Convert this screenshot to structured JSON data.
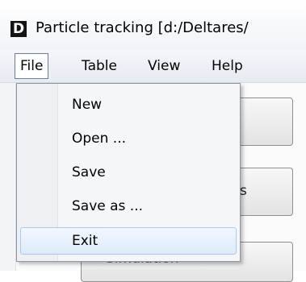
{
  "window": {
    "app_icon_letter": "D",
    "title": "Particle tracking  [d:/Deltares/"
  },
  "menubar": {
    "items": [
      {
        "label": "File",
        "active": true
      },
      {
        "label": "Table"
      },
      {
        "label": "View"
      },
      {
        "label": "Help"
      }
    ]
  },
  "file_menu": {
    "items": [
      {
        "label": "New"
      },
      {
        "label": "Open ..."
      },
      {
        "label": "Save"
      },
      {
        "label": "Save as ..."
      },
      {
        "label": "Exit",
        "highlighted": true
      }
    ]
  },
  "background": {
    "partial_button_text": "s",
    "bottom_button_text": "Simulation"
  },
  "colors": {
    "menu_highlight": "#dcebfb",
    "menu_highlight_border": "#a8c8ec",
    "active_menu_border": "#6e7c8f"
  },
  "icons": {
    "app": "deltares-d-icon"
  }
}
